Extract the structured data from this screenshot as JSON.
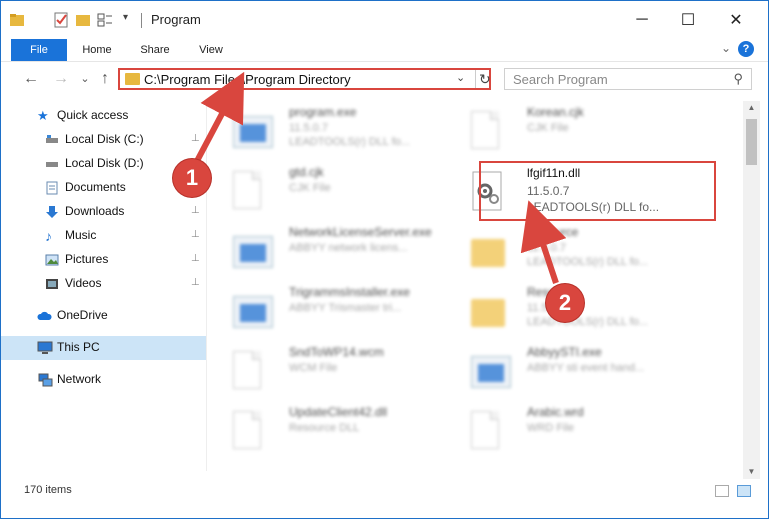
{
  "window": {
    "title": "Program",
    "controls": {
      "minimize": "─",
      "maximize": "☐",
      "close": "✕"
    }
  },
  "ribbon": {
    "tabs": [
      "File",
      "Home",
      "Share",
      "View"
    ],
    "collapse_glyph": "⌄",
    "help_glyph": "?"
  },
  "navbar": {
    "back": "←",
    "forward": "→",
    "recent": "⌄",
    "up": "↑",
    "address": "C:\\Program Files\\Program Directory",
    "address_dropdown": "⌄",
    "refresh": "↻",
    "search_placeholder": "Search Program"
  },
  "sidebar": {
    "items": [
      {
        "label": "Quick access",
        "icon": "star-icon",
        "pinned": false
      },
      {
        "label": "Local Disk (C:)",
        "icon": "drive-icon",
        "pinned": true
      },
      {
        "label": "Local Disk (D:)",
        "icon": "drive-icon",
        "pinned": false
      },
      {
        "label": "Documents",
        "icon": "documents-icon",
        "pinned": true
      },
      {
        "label": "Downloads",
        "icon": "download-icon",
        "pinned": true
      },
      {
        "label": "Music",
        "icon": "music-icon",
        "pinned": true
      },
      {
        "label": "Pictures",
        "icon": "pictures-icon",
        "pinned": true
      },
      {
        "label": "Videos",
        "icon": "videos-icon",
        "pinned": true
      },
      {
        "label": "OneDrive",
        "icon": "cloud-icon",
        "pinned": false
      },
      {
        "label": "This PC",
        "icon": "computer-icon",
        "pinned": false,
        "selected": true
      },
      {
        "label": "Network",
        "icon": "network-icon",
        "pinned": false
      }
    ],
    "pin_glyph": "📌"
  },
  "files": {
    "left": [
      {
        "name": "program.exe",
        "line2": "11.5.0.7",
        "line3": "LEADTOOLS(r) DLL fo...",
        "kind": "exe"
      },
      {
        "name": "gtd.cjk",
        "line2": "CJK File",
        "line3": "",
        "kind": "doc"
      },
      {
        "name": "NetworkLicenseServer.exe",
        "line2": "ABBYY network licens...",
        "line3": "",
        "kind": "exe"
      },
      {
        "name": "TrigrammsInstaller.exe",
        "line2": "ABBYY Trismaster tri...",
        "line3": "",
        "kind": "exe"
      },
      {
        "name": "SndToWP14.wcm",
        "line2": "WCM File",
        "line3": "",
        "kind": "doc"
      },
      {
        "name": "UpdateClient42.dll",
        "line2": "Resource DLL",
        "line3": "",
        "kind": "doc"
      }
    ],
    "right": [
      {
        "name": "Korean.cjk",
        "line2": "CJK File",
        "line3": "",
        "kind": "doc"
      },
      {
        "name": "lfgif11n.dll",
        "line2": "11.5.0.7",
        "line3": "LEADTOOLS(r) DLL fo...",
        "kind": "dll",
        "highlighted": true
      },
      {
        "name": "Resource",
        "line2": "11.5.0.7",
        "line3": "LEADTOOLS(r) DLL fo...",
        "kind": "folder"
      },
      {
        "name": "Resource",
        "line2": "11.5.0.7",
        "line3": "LEADTOOLS(r) DLL fo...",
        "kind": "folder"
      },
      {
        "name": "AbbyySTI.exe",
        "line2": "ABBYY sti event hand...",
        "line3": "",
        "kind": "exe"
      },
      {
        "name": "Arabic.wrd",
        "line2": "WRD File",
        "line3": "",
        "kind": "doc"
      }
    ]
  },
  "statusbar": {
    "item_count": "170 items"
  },
  "annotations": {
    "step1": "1",
    "step2": "2"
  },
  "colors": {
    "accent": "#1a73d9",
    "highlight": "#d9463e",
    "selected": "#cce4f7"
  }
}
